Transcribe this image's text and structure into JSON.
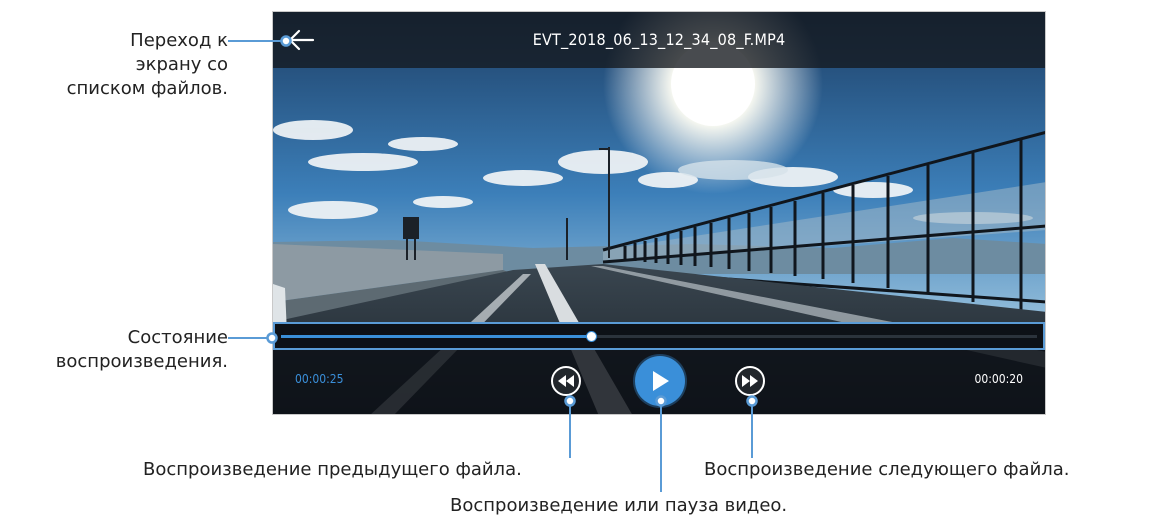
{
  "player": {
    "file_name": "EVT_2018_06_13_12_34_08_F.MP4",
    "time_elapsed": "00:00:25",
    "time_total": "00:00:20",
    "progress_fraction": 0.41,
    "icons": {
      "back": "arrow-left-icon",
      "previous": "rewind-icon",
      "play": "play-icon",
      "next": "fast-forward-icon"
    },
    "colors": {
      "accent": "#3a8fd9",
      "callout_line": "#5a9bd6"
    }
  },
  "callouts": {
    "back": [
      "Переход к",
      "экрану со",
      "списком файлов."
    ],
    "progress": [
      "Состояние",
      "воспроизведения."
    ],
    "previous": "Воспроизведение предыдущего файла.",
    "play_pause": "Воспроизведение или пауза видео.",
    "next": "Воспроизведение следующего файла."
  }
}
